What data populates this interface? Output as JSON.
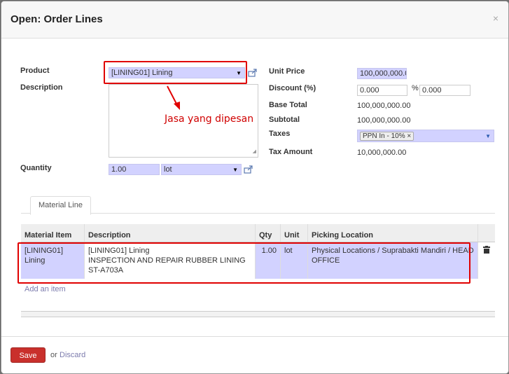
{
  "dialog": {
    "title": "Open: Order Lines",
    "close_label": "×"
  },
  "form": {
    "product_label": "Product",
    "product_value": "[LINING01] Lining",
    "description_label": "Description",
    "quantity_label": "Quantity",
    "quantity_value": "1.00",
    "uom_value": "lot",
    "unit_price_label": "Unit Price",
    "unit_price_value": "100,000,000.0",
    "discount_label": "Discount (%)",
    "discount_value": "0.000",
    "percent_sign": "%",
    "discount2_value": "0.000",
    "base_total_label": "Base Total",
    "base_total_value": "100,000,000.00",
    "subtotal_label": "Subtotal",
    "subtotal_value": "100,000,000.00",
    "taxes_label": "Taxes",
    "tax_tag": "PPN In - 10%",
    "tax_tag_remove": "×",
    "tax_amount_label": "Tax Amount",
    "tax_amount_value": "10,000,000.00"
  },
  "annotation": {
    "text": "Jasa yang dipesan",
    "color": "#d00000"
  },
  "tabs": [
    {
      "label": "Material Line"
    }
  ],
  "material_table": {
    "columns": [
      "Material Item",
      "Description",
      "Qty",
      "Unit",
      "Picking Location"
    ],
    "rows": [
      {
        "material_item": "[LINING01] Lining",
        "description": "[LINING01] Lining\nINSPECTION AND REPAIR RUBBER LINING\nST-A703A",
        "qty": "1.00",
        "unit": "lot",
        "picking_location": "Physical Locations / Suprabakti Mandiri / HEAD OFFICE",
        "delete_icon": "trash-icon"
      }
    ],
    "add_item_label": "Add an item"
  },
  "footer": {
    "save_label": "Save",
    "or_label": "or",
    "discard_label": "Discard"
  },
  "colors": {
    "required_field": "#d2d2ff",
    "save_button": "#c9302c",
    "link": "#7c7bad",
    "highlight_box": "#e00000"
  }
}
